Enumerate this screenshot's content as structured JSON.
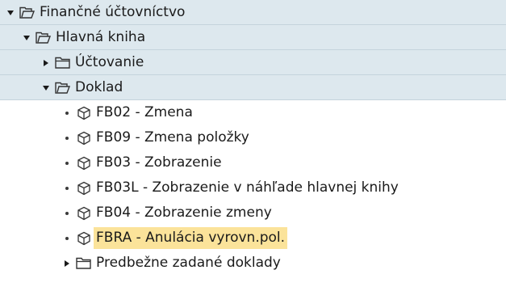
{
  "tree": {
    "items": [
      {
        "label": "Finančné účtovníctvo"
      },
      {
        "label": "Hlavná kniha"
      },
      {
        "label": "Účtovanie"
      },
      {
        "label": "Doklad"
      },
      {
        "label": "FB02 - Zmena"
      },
      {
        "label": "FB09 - Zmena položky"
      },
      {
        "label": "FB03 - Zobrazenie"
      },
      {
        "label": "FB03L - Zobrazenie v náhľade hlavnej knihy"
      },
      {
        "label": "FB04 - Zobrazenie zmeny"
      },
      {
        "label": "FBRA - Anulácia vyrovn.pol."
      },
      {
        "label": "Predbežne zadané doklady"
      }
    ]
  },
  "colors": {
    "folder_row_background": "#dde8ee",
    "selection_highlight": "#fbe39a",
    "icon_stroke": "#333333"
  },
  "icons": {
    "folder_open": "folder-open-icon",
    "folder_closed": "folder-closed-icon",
    "transaction": "transaction-cube-icon"
  }
}
